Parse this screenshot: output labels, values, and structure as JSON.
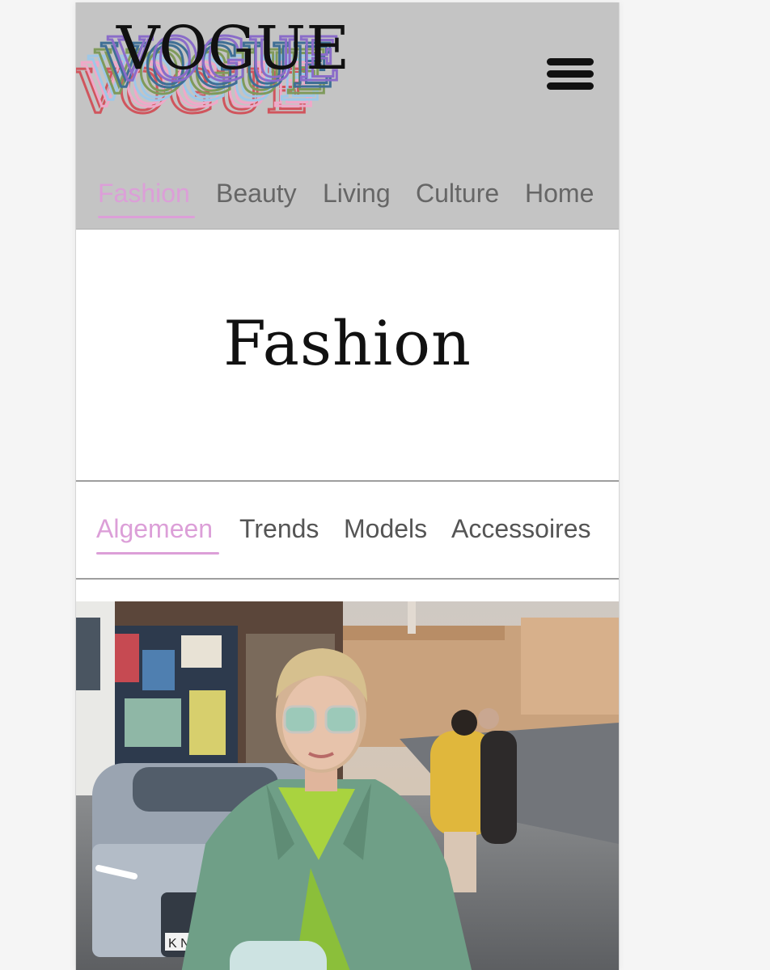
{
  "brand": {
    "logo_text": "VOGUE"
  },
  "header": {
    "menu_icon": "hamburger-menu-icon"
  },
  "main_nav": [
    {
      "label": "Fashion",
      "active": true
    },
    {
      "label": "Beauty",
      "active": false
    },
    {
      "label": "Living",
      "active": false
    },
    {
      "label": "Culture",
      "active": false
    },
    {
      "label": "Home",
      "active": false
    }
  ],
  "page": {
    "title": "Fashion"
  },
  "sub_nav": [
    {
      "label": "Algemeen",
      "active": true
    },
    {
      "label": "Trends",
      "active": false
    },
    {
      "label": "Models",
      "active": false
    },
    {
      "label": "Accessoires",
      "active": false
    }
  ],
  "colors": {
    "accent": "#dc9fd8",
    "header_bg": "#c4c4c4",
    "nav_text": "#666666"
  },
  "hero": {
    "image": "street-style-photo",
    "license_plate": "K N"
  }
}
